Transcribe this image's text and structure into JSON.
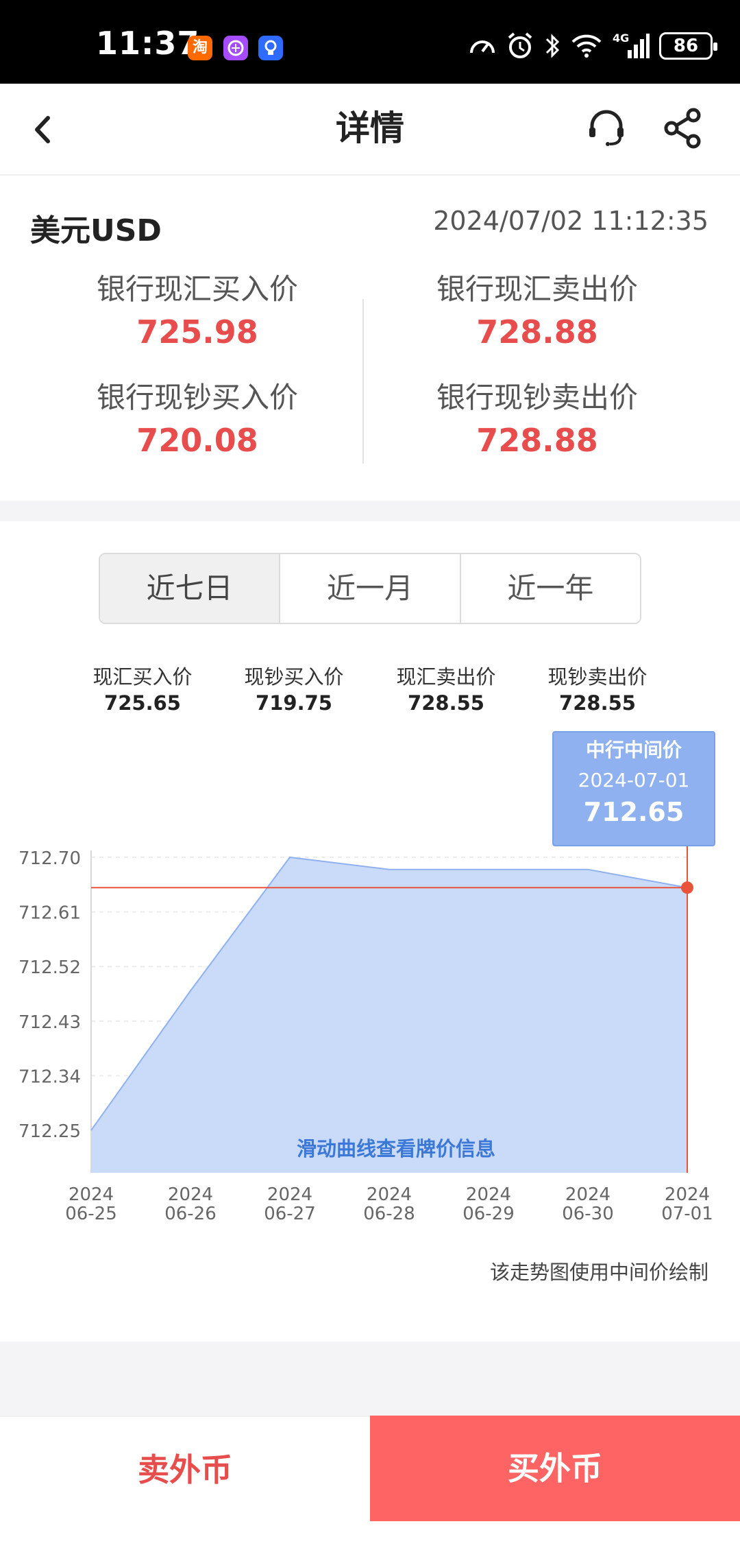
{
  "status_bar": {
    "time": "11:37",
    "app_badges": [
      "taobao-icon",
      "purple-app-icon",
      "lightbulb-app-icon"
    ],
    "taobao_glyph": "淘",
    "network": "4G",
    "battery": "86"
  },
  "header": {
    "title": "详情",
    "icons": [
      "back-icon",
      "customer-service-icon",
      "share-icon"
    ]
  },
  "rate_card": {
    "currency": "美元USD",
    "timestamp": "2024/07/02 11:12:35",
    "cells": [
      {
        "label": "银行现汇买入价",
        "value": "725.98"
      },
      {
        "label": "银行现汇卖出价",
        "value": "728.88"
      },
      {
        "label": "银行现钞买入价",
        "value": "720.08"
      },
      {
        "label": "银行现钞卖出价",
        "value": "728.88"
      }
    ],
    "value_color": "#e84d4d"
  },
  "range_tabs": {
    "items": [
      "近七日",
      "近一月",
      "近一年"
    ],
    "active_index": 0
  },
  "summary": [
    {
      "label": "现汇买入价",
      "value": "725.65"
    },
    {
      "label": "现钞买入价",
      "value": "719.75"
    },
    {
      "label": "现汇卖出价",
      "value": "728.55"
    },
    {
      "label": "现钞卖出价",
      "value": "728.55"
    }
  ],
  "tooltip": {
    "title": "中行中间价",
    "date": "2024-07-01",
    "value": "712.65"
  },
  "chart_data": {
    "type": "area",
    "x": [
      "2024\n06-25",
      "2024\n06-26",
      "2024\n06-27",
      "2024\n06-28",
      "2024\n06-29",
      "2024\n06-30",
      "2024\n07-01"
    ],
    "x_lines": [
      [
        "2024",
        "06-25"
      ],
      [
        "2024",
        "06-26"
      ],
      [
        "2024",
        "06-27"
      ],
      [
        "2024",
        "06-28"
      ],
      [
        "2024",
        "06-29"
      ],
      [
        "2024",
        "06-30"
      ],
      [
        "2024",
        "07-01"
      ]
    ],
    "values": [
      712.25,
      712.48,
      712.7,
      712.68,
      712.68,
      712.68,
      712.65
    ],
    "yticks": [
      "712.70",
      "712.61",
      "712.52",
      "712.43",
      "712.34",
      "712.25"
    ],
    "ylim": [
      712.18,
      712.7
    ],
    "highlight_index": 6,
    "fill_color": "#c9dbf8",
    "line_color": "#8fb1ef",
    "crosshair_color": "#e8533a",
    "grid": true,
    "annotation": "滑动曲线查看牌价信息"
  },
  "chart_note": "该走势图使用中间价绘制",
  "actions": {
    "sell": "卖外币",
    "buy": "买外币",
    "sell_color": "#e84d4d",
    "buy_bg": "#ff6464"
  }
}
